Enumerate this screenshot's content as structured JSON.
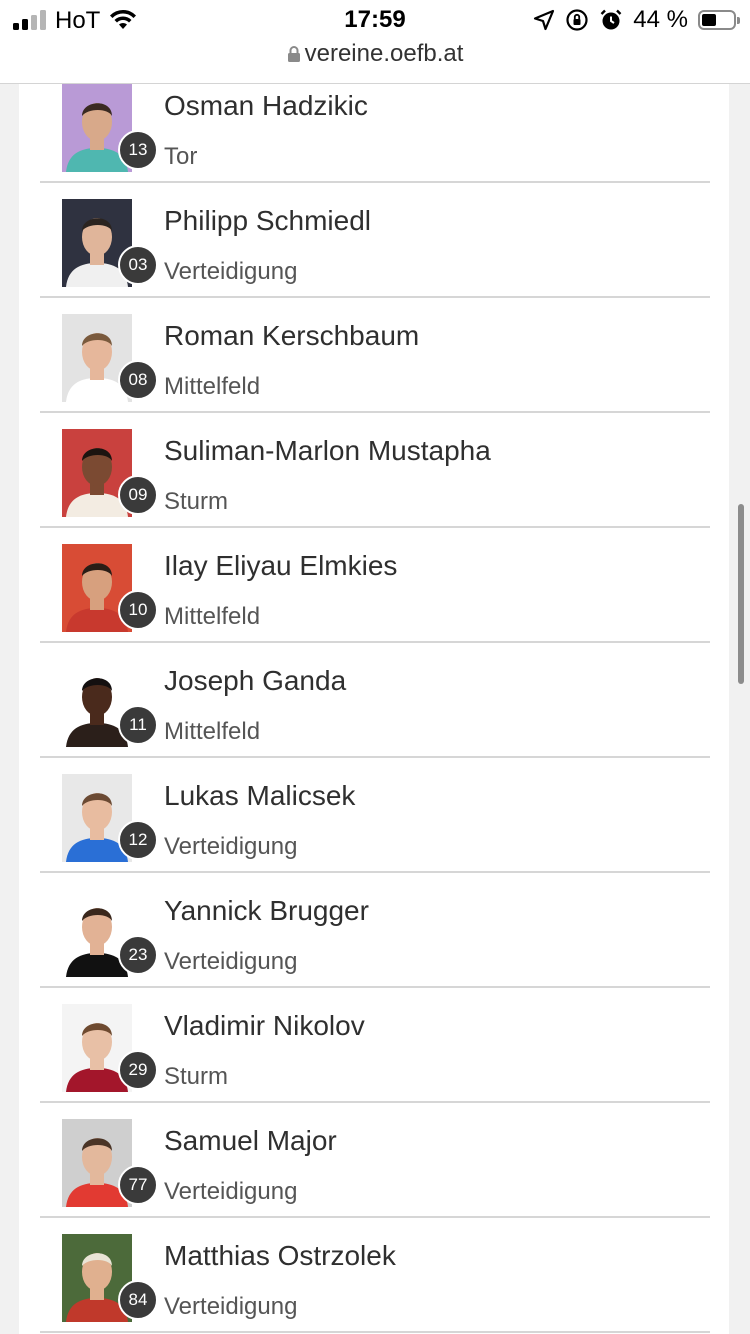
{
  "status_bar": {
    "carrier": "HoT",
    "time": "17:59",
    "battery_percent": "44 %",
    "url": "vereine.oefb.at"
  },
  "players": [
    {
      "name": "Osman Hadzikic",
      "position": "Tor",
      "number": "13",
      "bg": "#b99ad6",
      "shirt": "#4fb7b0",
      "skin": "#d8a98a",
      "hair": "#3a2a22"
    },
    {
      "name": "Philipp Schmiedl",
      "position": "Verteidigung",
      "number": "03",
      "bg": "#2f3240",
      "shirt": "#f0f0f0",
      "skin": "#e0b59a",
      "hair": "#2b2420"
    },
    {
      "name": "Roman Kerschbaum",
      "position": "Mittelfeld",
      "number": "08",
      "bg": "#e3e3e3",
      "shirt": "#ffffff",
      "skin": "#e6b79b",
      "hair": "#7a5a3d"
    },
    {
      "name": "Suliman-Marlon Mustapha",
      "position": "Sturm",
      "number": "09",
      "bg": "#c9413e",
      "shirt": "#f3ece2",
      "skin": "#7b4a32",
      "hair": "#1c1410"
    },
    {
      "name": "Ilay Eliyau Elmkies",
      "position": "Mittelfeld",
      "number": "10",
      "bg": "#d84c35",
      "shirt": "#c8392e",
      "skin": "#d7a07e",
      "hair": "#2a1d16"
    },
    {
      "name": "Joseph Ganda",
      "position": "Mittelfeld",
      "number": "11",
      "bg": "#ffffff",
      "shirt": "#2b1f1a",
      "skin": "#4a2a1c",
      "hair": "#141010"
    },
    {
      "name": "Lukas Malicsek",
      "position": "Verteidigung",
      "number": "12",
      "bg": "#e8e8e8",
      "shirt": "#2a6fd6",
      "skin": "#e8bca0",
      "hair": "#6b4a33"
    },
    {
      "name": "Yannick Brugger",
      "position": "Verteidigung",
      "number": "23",
      "bg": "#ffffff",
      "shirt": "#111111",
      "skin": "#e2b295",
      "hair": "#3a271c"
    },
    {
      "name": "Vladimir Nikolov",
      "position": "Sturm",
      "number": "29",
      "bg": "#f4f4f4",
      "shirt": "#a3162b",
      "skin": "#e8c0a6",
      "hair": "#6e4a30"
    },
    {
      "name": "Samuel Major",
      "position": "Verteidigung",
      "number": "77",
      "bg": "#cfcfcf",
      "shirt": "#e23a32",
      "skin": "#e3b89c",
      "hair": "#4a3426"
    },
    {
      "name": "Matthias Ostrzolek",
      "position": "Verteidigung",
      "number": "84",
      "bg": "#4c6a3a",
      "shirt": "#c0392b",
      "skin": "#e0b08f",
      "hair": "#e9e4d6"
    }
  ]
}
